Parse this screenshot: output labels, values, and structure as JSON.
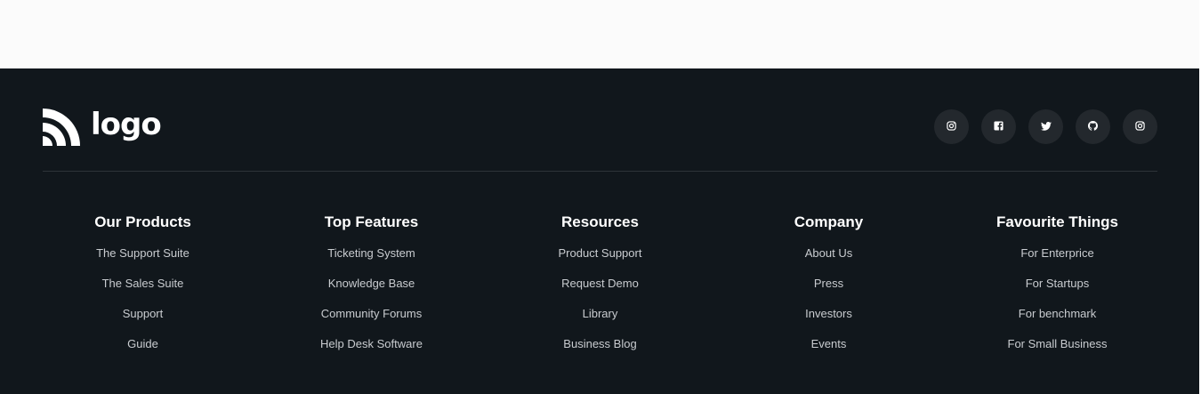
{
  "brand": {
    "name": "logo",
    "icon": "rss-logo-icon"
  },
  "socials": [
    {
      "icon": "instagram-icon"
    },
    {
      "icon": "facebook-icon"
    },
    {
      "icon": "twitter-icon"
    },
    {
      "icon": "github-icon"
    },
    {
      "icon": "instagram-icon"
    }
  ],
  "columns": [
    {
      "title": "Our Products",
      "links": [
        "The Support Suite",
        "The Sales Suite",
        "Support",
        "Guide"
      ]
    },
    {
      "title": "Top Features",
      "links": [
        "Ticketing System",
        "Knowledge Base",
        "Community Forums",
        "Help Desk Software"
      ]
    },
    {
      "title": "Resources",
      "links": [
        "Product Support",
        "Request Demo",
        "Library",
        "Business Blog"
      ]
    },
    {
      "title": "Company",
      "links": [
        "About Us",
        "Press",
        "Investors",
        "Events"
      ]
    },
    {
      "title": "Favourite Things",
      "links": [
        "For Enterprice",
        "For Startups",
        "For benchmark",
        "For Small Business"
      ]
    }
  ],
  "colors": {
    "footer_bg": "#11171c",
    "social_bg": "#23282d",
    "link": "#c9ccd0",
    "heading": "#ffffff"
  }
}
